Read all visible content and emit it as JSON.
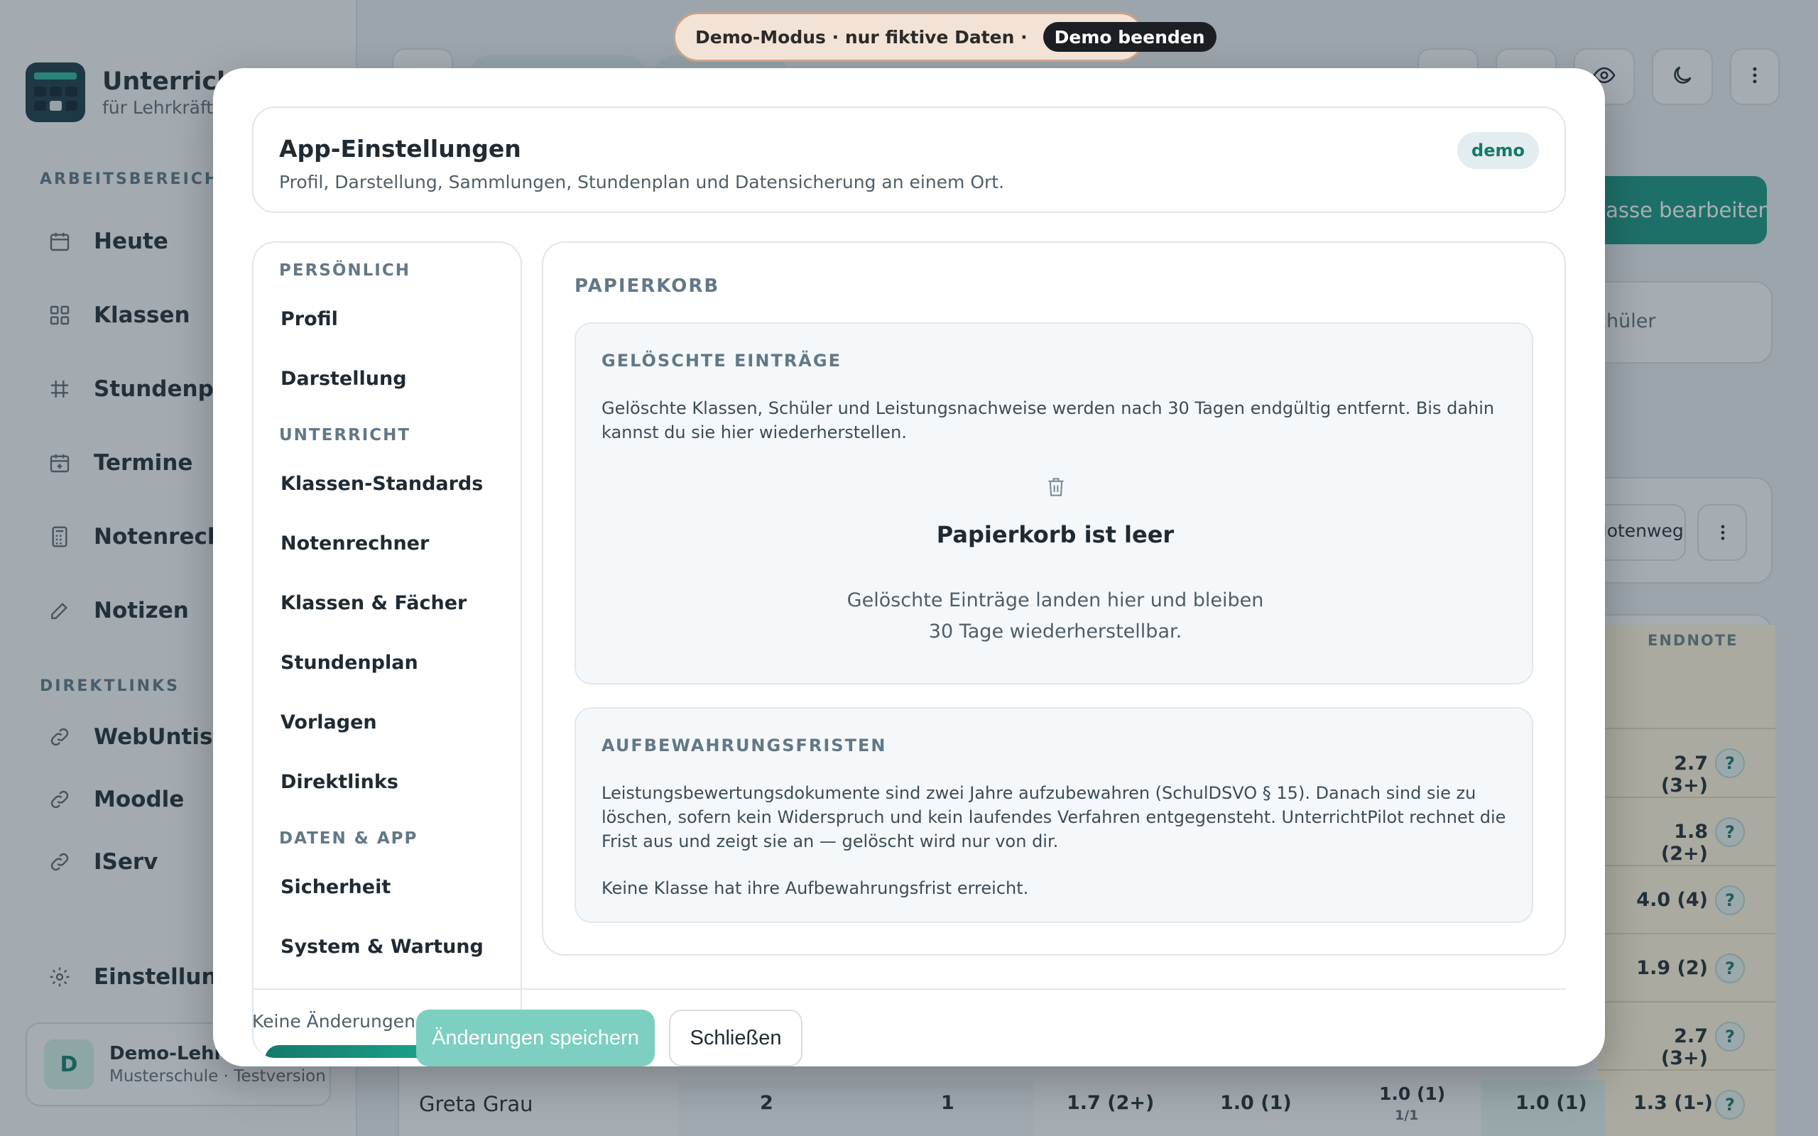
{
  "banner": {
    "text": "Demo-Modus · nur fiktive Daten ·",
    "end_label": "Demo beenden"
  },
  "app": {
    "title": "UnterrichtPilot",
    "subtitle": "für Lehrkräfte"
  },
  "sidebar": {
    "section_work": "ARBEITSBEREICH",
    "section_links": "DIREKTLINKS",
    "items": [
      {
        "label": "Heute",
        "icon": "calendar-icon"
      },
      {
        "label": "Klassen",
        "icon": "grid-icon"
      },
      {
        "label": "Stundenplan",
        "icon": "timetable-icon"
      },
      {
        "label": "Termine",
        "icon": "calendar-plus-icon"
      },
      {
        "label": "Notenrechner",
        "icon": "calculator-icon"
      },
      {
        "label": "Notizen",
        "icon": "pencil-icon"
      }
    ],
    "links": [
      {
        "label": "WebUntis",
        "icon": "link-icon"
      },
      {
        "label": "Moodle",
        "icon": "link-icon"
      },
      {
        "label": "IServ",
        "icon": "link-icon"
      }
    ],
    "settings_label": "Einstellungen",
    "user": {
      "initial": "D",
      "name": "Demo-Lehrkraft",
      "school": "Musterschule · Testversion"
    }
  },
  "background": {
    "cta_label": "Klasse bearbeiten",
    "card_text": "Schüler",
    "filter_text": "Notenweg",
    "endnote_header": "ENDNOTE",
    "grades": [
      "2.7 (3+)",
      "1.8 (2+)",
      "4.0 (4)",
      "1.9 (2)",
      "2.7 (3+)",
      "1.3 (1-)"
    ],
    "last_row": {
      "name": "Greta Grau",
      "cells": [
        "2",
        "1",
        "1.7 (2+)",
        "1.0 (1)",
        "1.0 (1)",
        "1/1",
        "1.0 (1)",
        "1.3 (1-)"
      ]
    }
  },
  "modal": {
    "title": "App-Einstellungen",
    "subtitle": "Profil, Darstellung, Sammlungen, Stundenplan und Datensicherung an einem Ort.",
    "badge": "demo",
    "nav": {
      "sections": [
        "PERSÖNLICH",
        "UNTERRICHT",
        "DATEN & APP"
      ],
      "personal": [
        "Profil",
        "Darstellung"
      ],
      "teaching": [
        "Klassen-Standards",
        "Notenrechner",
        "Klassen & Fächer",
        "Stundenplan",
        "Vorlagen",
        "Direktlinks"
      ],
      "data": [
        "Sicherheit",
        "System & Wartung"
      ]
    },
    "content": {
      "section_title": "PAPIERKORB",
      "deleted": {
        "title": "GELÖSCHTE EINTRÄGE",
        "text": "Gelöschte Klassen, Schüler und Leistungsnachweise werden nach 30 Tagen endgültig entfernt. Bis dahin kannst du sie hier wiederherstellen.",
        "empty_title": "Papierkorb ist leer",
        "empty_text": "Gelöschte Einträge landen hier und bleiben 30 Tage wiederherstellbar."
      },
      "retention": {
        "title": "AUFBEWAHRUNGSFRISTEN",
        "text": "Leistungsbewertungsdokumente sind zwei Jahre aufzubewahren (SchulDSVO § 15). Danach sind sie zu löschen, sofern kein Widerspruch und kein laufendes Verfahren entgegensteht. UnterrichtPilot rechnet die Frist aus und zeigt sie an — gelöscht wird nur von dir.",
        "status": "Keine Klasse hat ihre Aufbewahrungsfrist erreicht."
      }
    },
    "footer": {
      "status": "Keine Änderungen",
      "save_label": "Änderungen speichern",
      "close_label": "Schließen"
    }
  }
}
